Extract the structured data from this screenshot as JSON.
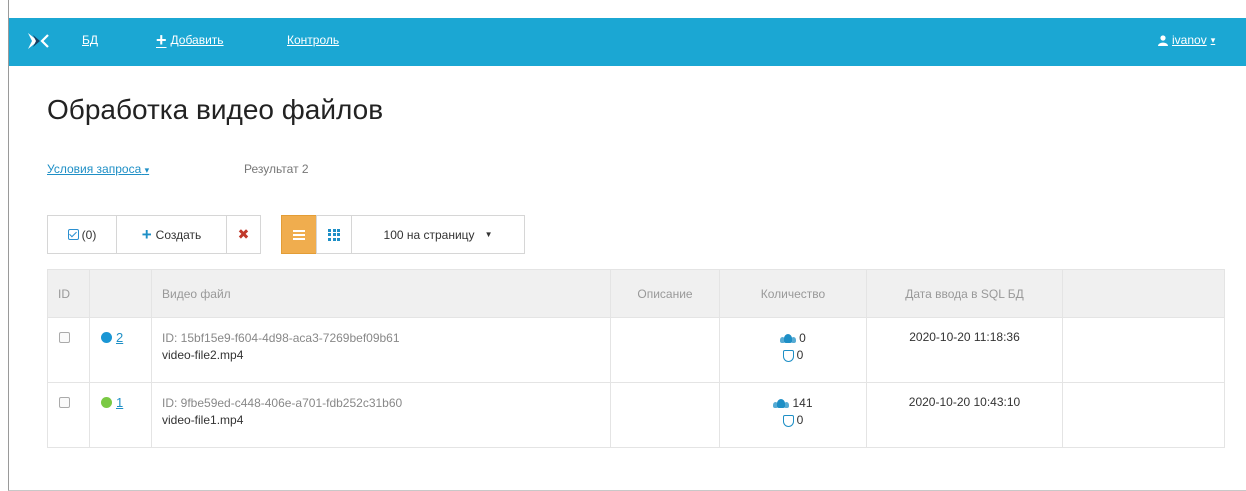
{
  "navbar": {
    "db_label": "БД",
    "add_label": "Добавить",
    "control_label": "Контроль",
    "user_label": "ivanov"
  },
  "page": {
    "title": "Обработка видео файлов",
    "conditions_label": "Условия запроса",
    "result_text": "Результат 2"
  },
  "toolbar": {
    "selected_count": "(0)",
    "create_label": "Создать",
    "delete_icon": "✖",
    "per_page_label": "100 на страницу"
  },
  "table": {
    "headers": {
      "id": "ID",
      "video_file": "Видео файл",
      "description": "Описание",
      "count": "Количество",
      "date": "Дата ввода в SQL БД"
    },
    "rows": [
      {
        "status_color": "#1a96d4",
        "number": "2",
        "file_id": "ID: 15bf15e9-f604-4d98-aca3-7269bef09b61",
        "file_name": "video-file2.mp4",
        "description": "",
        "users_count": "0",
        "shield_count": "0",
        "date": "2020-10-20 11:18:36"
      },
      {
        "status_color": "#7ac943",
        "number": "1",
        "file_id": "ID: 9fbe59ed-c448-406e-a701-fdb252c31b60",
        "file_name": "video-file1.mp4",
        "description": "",
        "users_count": "141",
        "shield_count": "0",
        "date": "2020-10-20 10:43:10"
      }
    ]
  },
  "colors": {
    "navbar": "#1ba7d3",
    "link": "#1e8fc6",
    "active_view": "#f0ad4e"
  }
}
